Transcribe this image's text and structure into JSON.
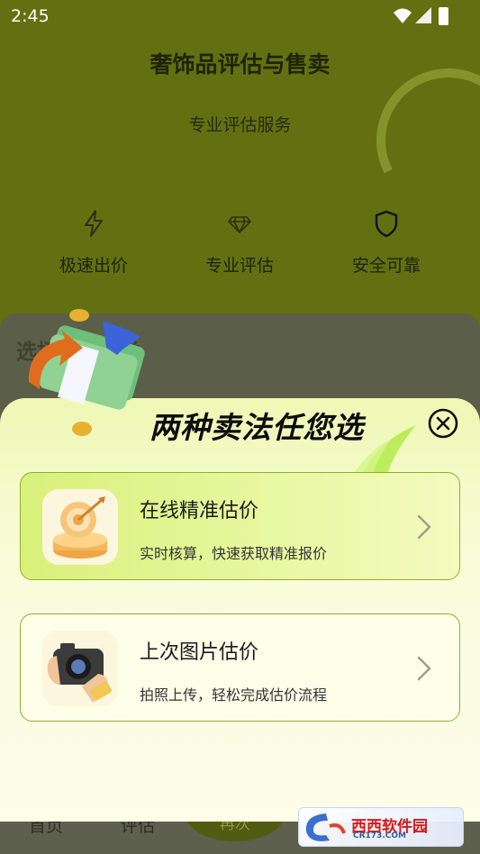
{
  "status_bar": {
    "time": "2:45",
    "icons": [
      "wifi-icon",
      "signal-icon",
      "battery-icon"
    ]
  },
  "header": {
    "title": "奢饰品评估与售卖",
    "subtitle": "专业评估服务"
  },
  "features": [
    {
      "icon": "lightning-icon",
      "label": "极速出价"
    },
    {
      "icon": "diamond-icon",
      "label": "专业评估"
    },
    {
      "icon": "shield-icon",
      "label": "安全可靠"
    }
  ],
  "underlay": {
    "section_title": "选择奢品品类"
  },
  "tabbar": {
    "home": "首页",
    "assess": "评估",
    "center": "再次"
  },
  "dialog": {
    "title": "两种卖法任您选",
    "options": [
      {
        "title": "在线精准估价",
        "desc": "实时核算，快速获取精准报价",
        "icon": "target-icon"
      },
      {
        "title": "上次图片估价",
        "desc": "拍照上传，轻松完成估价流程",
        "icon": "camera-icon"
      }
    ]
  },
  "watermark": {
    "text": "西西软件园",
    "url": "CR173.COM"
  },
  "colors": {
    "header_bg": "#627012",
    "accent": "#8fb02a",
    "card_highlight": "#d9f07a"
  }
}
